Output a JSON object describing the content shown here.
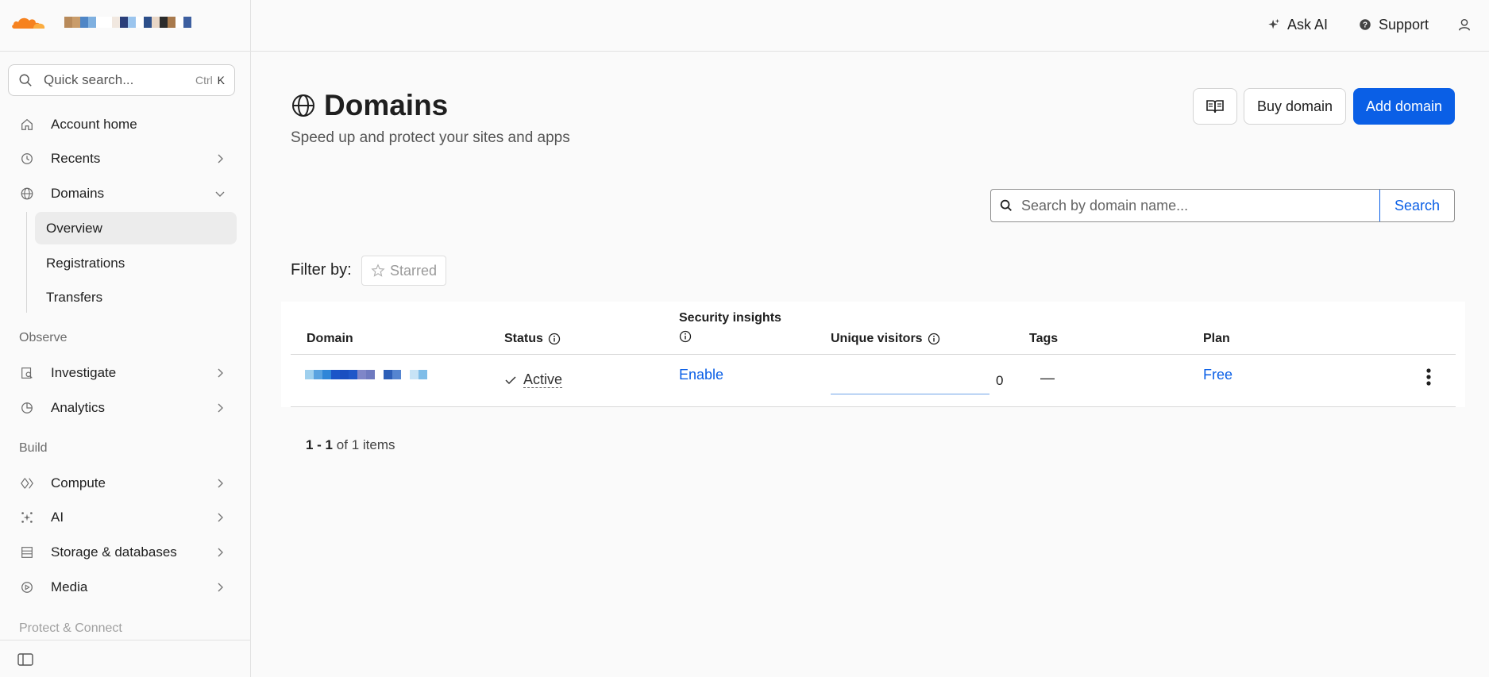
{
  "colors": {
    "accent": "#0a5fe6",
    "brand_orange": "#f6821f",
    "active_bg": "#ececec"
  },
  "account_name_redacted_colors": [
    "#b88a5a",
    "#c99c6a",
    "#4f86c6",
    "#7fb0e0",
    "#ffffff",
    "#ffffff",
    "#f1e8e0",
    "#2b3f7a",
    "#9bc5ee",
    "#ffffff",
    "#2d4f8a",
    "#e8d6c6",
    "#2b2b2b",
    "#a87a4d",
    "#ffffff",
    "#3d5fa0"
  ],
  "search": {
    "placeholder": "Quick search...",
    "shortcut_ctrl": "Ctrl",
    "shortcut_key": "K",
    "icon": "search-icon"
  },
  "sidebar": {
    "items": [
      {
        "label": "Account home",
        "icon": "home-icon"
      },
      {
        "label": "Recents",
        "icon": "history-icon"
      },
      {
        "label": "Domains",
        "icon": "globe-icon"
      }
    ],
    "domains_sub": [
      {
        "label": "Overview",
        "active": true
      },
      {
        "label": "Registrations"
      },
      {
        "label": "Transfers"
      }
    ],
    "section_observe": "Observe",
    "observe_items": [
      {
        "label": "Investigate",
        "icon": "investigate-icon"
      },
      {
        "label": "Analytics",
        "icon": "analytics-icon"
      }
    ],
    "section_build": "Build",
    "build_items": [
      {
        "label": "Compute",
        "icon": "compute-icon"
      },
      {
        "label": "AI",
        "icon": "ai-sparkle-icon"
      },
      {
        "label": "Storage & databases",
        "icon": "storage-icon"
      },
      {
        "label": "Media",
        "icon": "media-icon"
      }
    ],
    "section_protect": "Protect & Connect"
  },
  "topbar": {
    "ask_ai": "Ask AI",
    "support": "Support"
  },
  "page": {
    "title": "Domains",
    "subtitle": "Speed up and protect your sites and apps",
    "buy_domain": "Buy domain",
    "add_domain": "Add domain"
  },
  "domain_search": {
    "placeholder": "Search by domain name...",
    "button": "Search"
  },
  "filter": {
    "label": "Filter by:",
    "starred": "Starred"
  },
  "table": {
    "headers": {
      "domain": "Domain",
      "status": "Status",
      "security_line1": "Security insights",
      "unique_visitors": "Unique visitors",
      "tags": "Tags",
      "plan": "Plan"
    },
    "rows": [
      {
        "domain_redacted_colors": [
          "#9fd0ee",
          "#5aa3e0",
          "#2f86d8",
          "#1b55c8",
          "#1a4fc0",
          "#1f57c8",
          "#7f86c8",
          "#6f7ac0",
          "#ffffff",
          "#2d5fb8",
          "#5585d0",
          "#ffffff",
          "#c7e3f6",
          "#7fbde8"
        ],
        "status": "Active",
        "security": "Enable",
        "visitors": "0",
        "tags": "—",
        "plan": "Free"
      }
    ]
  },
  "pager": {
    "range": "1 - 1",
    "of": "of",
    "total": "1",
    "unit": "items"
  }
}
